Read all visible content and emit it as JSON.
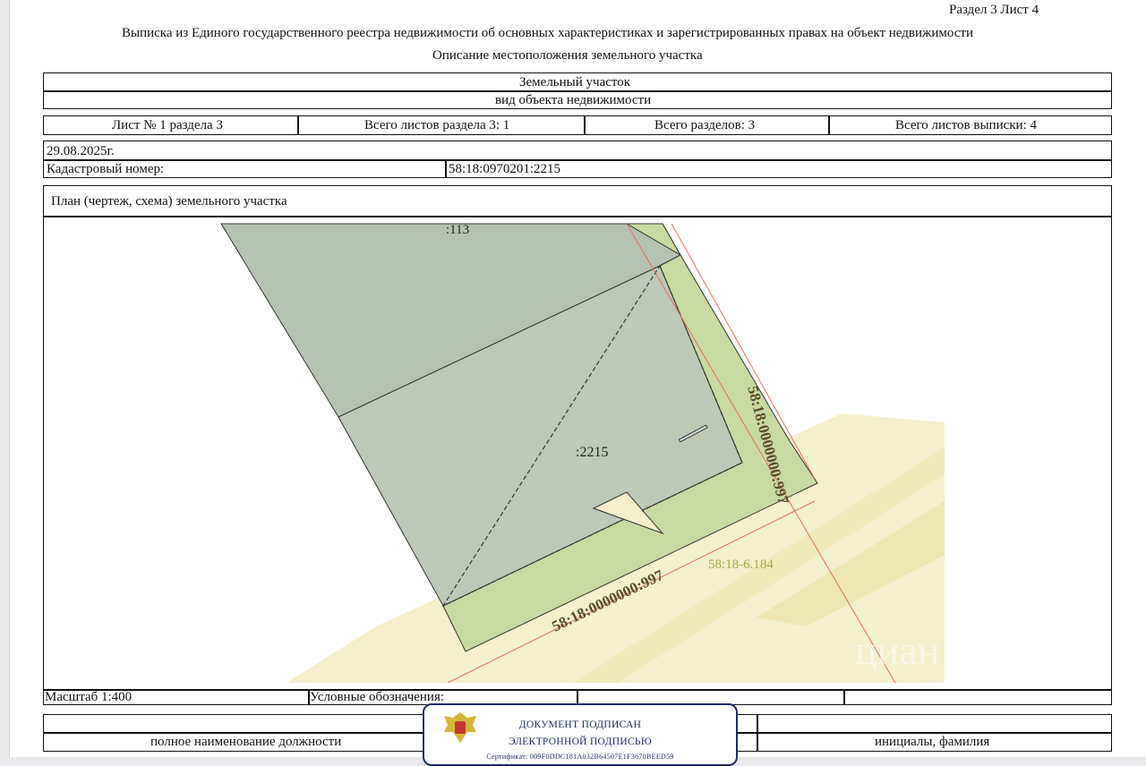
{
  "page_header": {
    "section_sheet": "Раздел 3    Лист 4",
    "title": "Выписка из Единого государственного реестра недвижимости об основных характеристиках и зарегистрированных правах на объект недвижимости",
    "subtitle": "Описание местоположения земельного участка"
  },
  "object": {
    "name": "Земельный участок",
    "kind_caption": "вид объекта недвижимости"
  },
  "sheets": {
    "sheet_no": "Лист № 1 раздела 3",
    "total_section_sheets": "Всего листов раздела 3: 1",
    "total_sections": "Всего разделов: 3",
    "total_extract_sheets": "Всего листов выписки: 4"
  },
  "date": "29.08.2025г.",
  "cadastral": {
    "label": "Кадастровый номер:",
    "value": "58:18:0970201:2215"
  },
  "plan": {
    "title": "План (чертеж, схема) земельного участка",
    "labels": {
      "parcel_113": ":113",
      "parcel_2215": ":2215",
      "quarter_vertical": "58:18:0000000:997",
      "quarter_bottom": "58:18:0000000:997",
      "zone": "58:18-6.184",
      "watermark": "циан"
    },
    "colors": {
      "parcel_gray": "#b6c2b1",
      "strip_green": "#c9d9a2",
      "zone_beige": "#f4efcc",
      "red_line": "#e07060",
      "label_brown": "#5a4a2a",
      "zone_label": "#a6a84a"
    }
  },
  "footer": {
    "scale": "Масштаб 1:400",
    "legend": "Условные обозначения:",
    "position_caption": "полное наименование должности",
    "initials_caption": "инициалы, фамилия"
  },
  "stamp": {
    "line1": "ДОКУМЕНТ ПОДПИСАН",
    "line2": "ЭЛЕКТРОННОЙ ПОДПИСЬЮ",
    "certificate": "Сертификат: 009F0DDC181A032B64507E1F3670BEED59"
  }
}
